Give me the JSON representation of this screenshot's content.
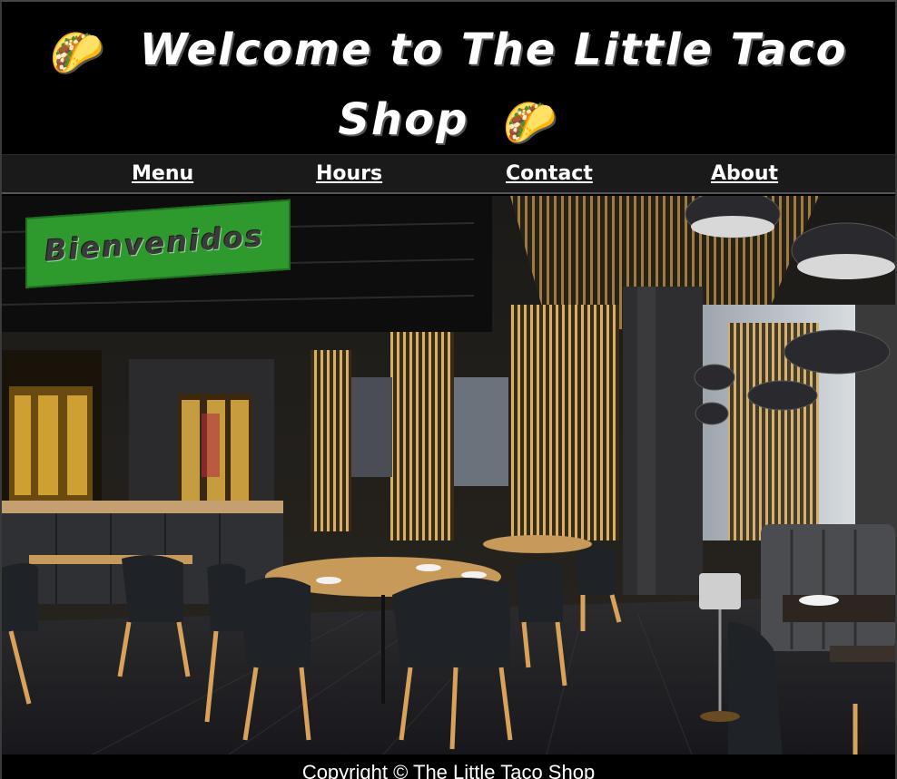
{
  "header": {
    "title_line1": "Welcome to The Little Taco",
    "title_line2": "Shop",
    "emoji": "🌮"
  },
  "nav": {
    "items": [
      {
        "label": "Menu"
      },
      {
        "label": "Hours"
      },
      {
        "label": "Contact"
      },
      {
        "label": "About"
      }
    ]
  },
  "hero": {
    "banner_text": "Bienvenidos",
    "image_subject": "restaurant-interior-photo"
  },
  "footer": {
    "copyright": "Copyright © The Little Taco Shop"
  },
  "colors": {
    "background": "#000000",
    "nav_background": "#1a1a1a",
    "banner_green": "#2e9a2e",
    "text": "#ffffff"
  }
}
